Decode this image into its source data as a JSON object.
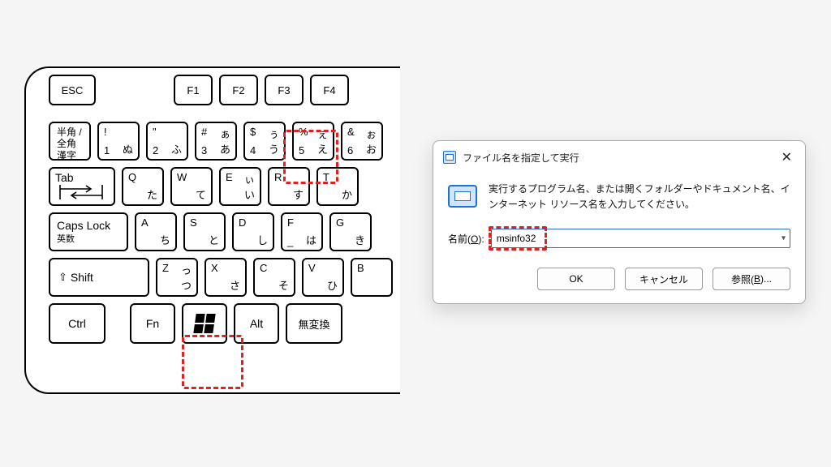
{
  "keyboard": {
    "row0": {
      "esc": "ESC",
      "f1": "F1",
      "f2": "F2",
      "f3": "F3",
      "f4": "F4"
    },
    "row1": {
      "hankaku": "半角 /\n全角\n漢字",
      "k1": {
        "tl": "!",
        "bl": "1",
        "br": "ぬ"
      },
      "k2": {
        "tl": "\"",
        "bl": "2",
        "br": "ふ"
      },
      "k3": {
        "tl": "#",
        "bl": "3",
        "tr": "ぁ",
        "br": "あ"
      },
      "k4": {
        "tl": "$",
        "bl": "4",
        "tr": "ぅ",
        "br": "う"
      },
      "k5": {
        "tl": "%",
        "bl": "5",
        "tr": "ぇ",
        "br": "え"
      },
      "k6": {
        "tl": "&",
        "bl": "6",
        "tr": "ぉ",
        "br": "お"
      }
    },
    "row2": {
      "tab": "Tab",
      "q": {
        "tl": "Q",
        "br": "た"
      },
      "w": {
        "tl": "W",
        "br": "て"
      },
      "e": {
        "tl": "E",
        "tr": "ぃ",
        "br": "い"
      },
      "r": {
        "tl": "R",
        "br": "す"
      },
      "t": {
        "tl": "T",
        "br": "か"
      }
    },
    "row3": {
      "caps_main": "Caps Lock",
      "caps_sub": "英数",
      "a": {
        "tl": "A",
        "br": "ち"
      },
      "s": {
        "tl": "S",
        "br": "と"
      },
      "d": {
        "tl": "D",
        "br": "し"
      },
      "f": {
        "tl": "F",
        "bl": "_",
        "br": "は"
      },
      "g": {
        "tl": "G",
        "br": "き"
      }
    },
    "row4": {
      "shift": "Shift",
      "z": {
        "tl": "Z",
        "tr": "っ",
        "br": "つ"
      },
      "x": {
        "tl": "X",
        "br": "さ"
      },
      "c": {
        "tl": "C",
        "br": "そ"
      },
      "v": {
        "tl": "V",
        "br": "ひ"
      },
      "b": {
        "tl": "B"
      }
    },
    "row5": {
      "ctrl": "Ctrl",
      "fn": "Fn",
      "alt": "Alt",
      "muhenkan": "無変換"
    }
  },
  "dialog": {
    "title": "ファイル名を指定して実行",
    "description": "実行するプログラム名、または開くフォルダーやドキュメント名、インターネット リソース名を入力してください。",
    "label_prefix": "名前(",
    "label_accel": "O",
    "label_suffix": "):",
    "value": "msinfo32",
    "ok": "OK",
    "cancel": "キャンセル",
    "browse_prefix": "参照(",
    "browse_accel": "B",
    "browse_suffix": ")..."
  }
}
